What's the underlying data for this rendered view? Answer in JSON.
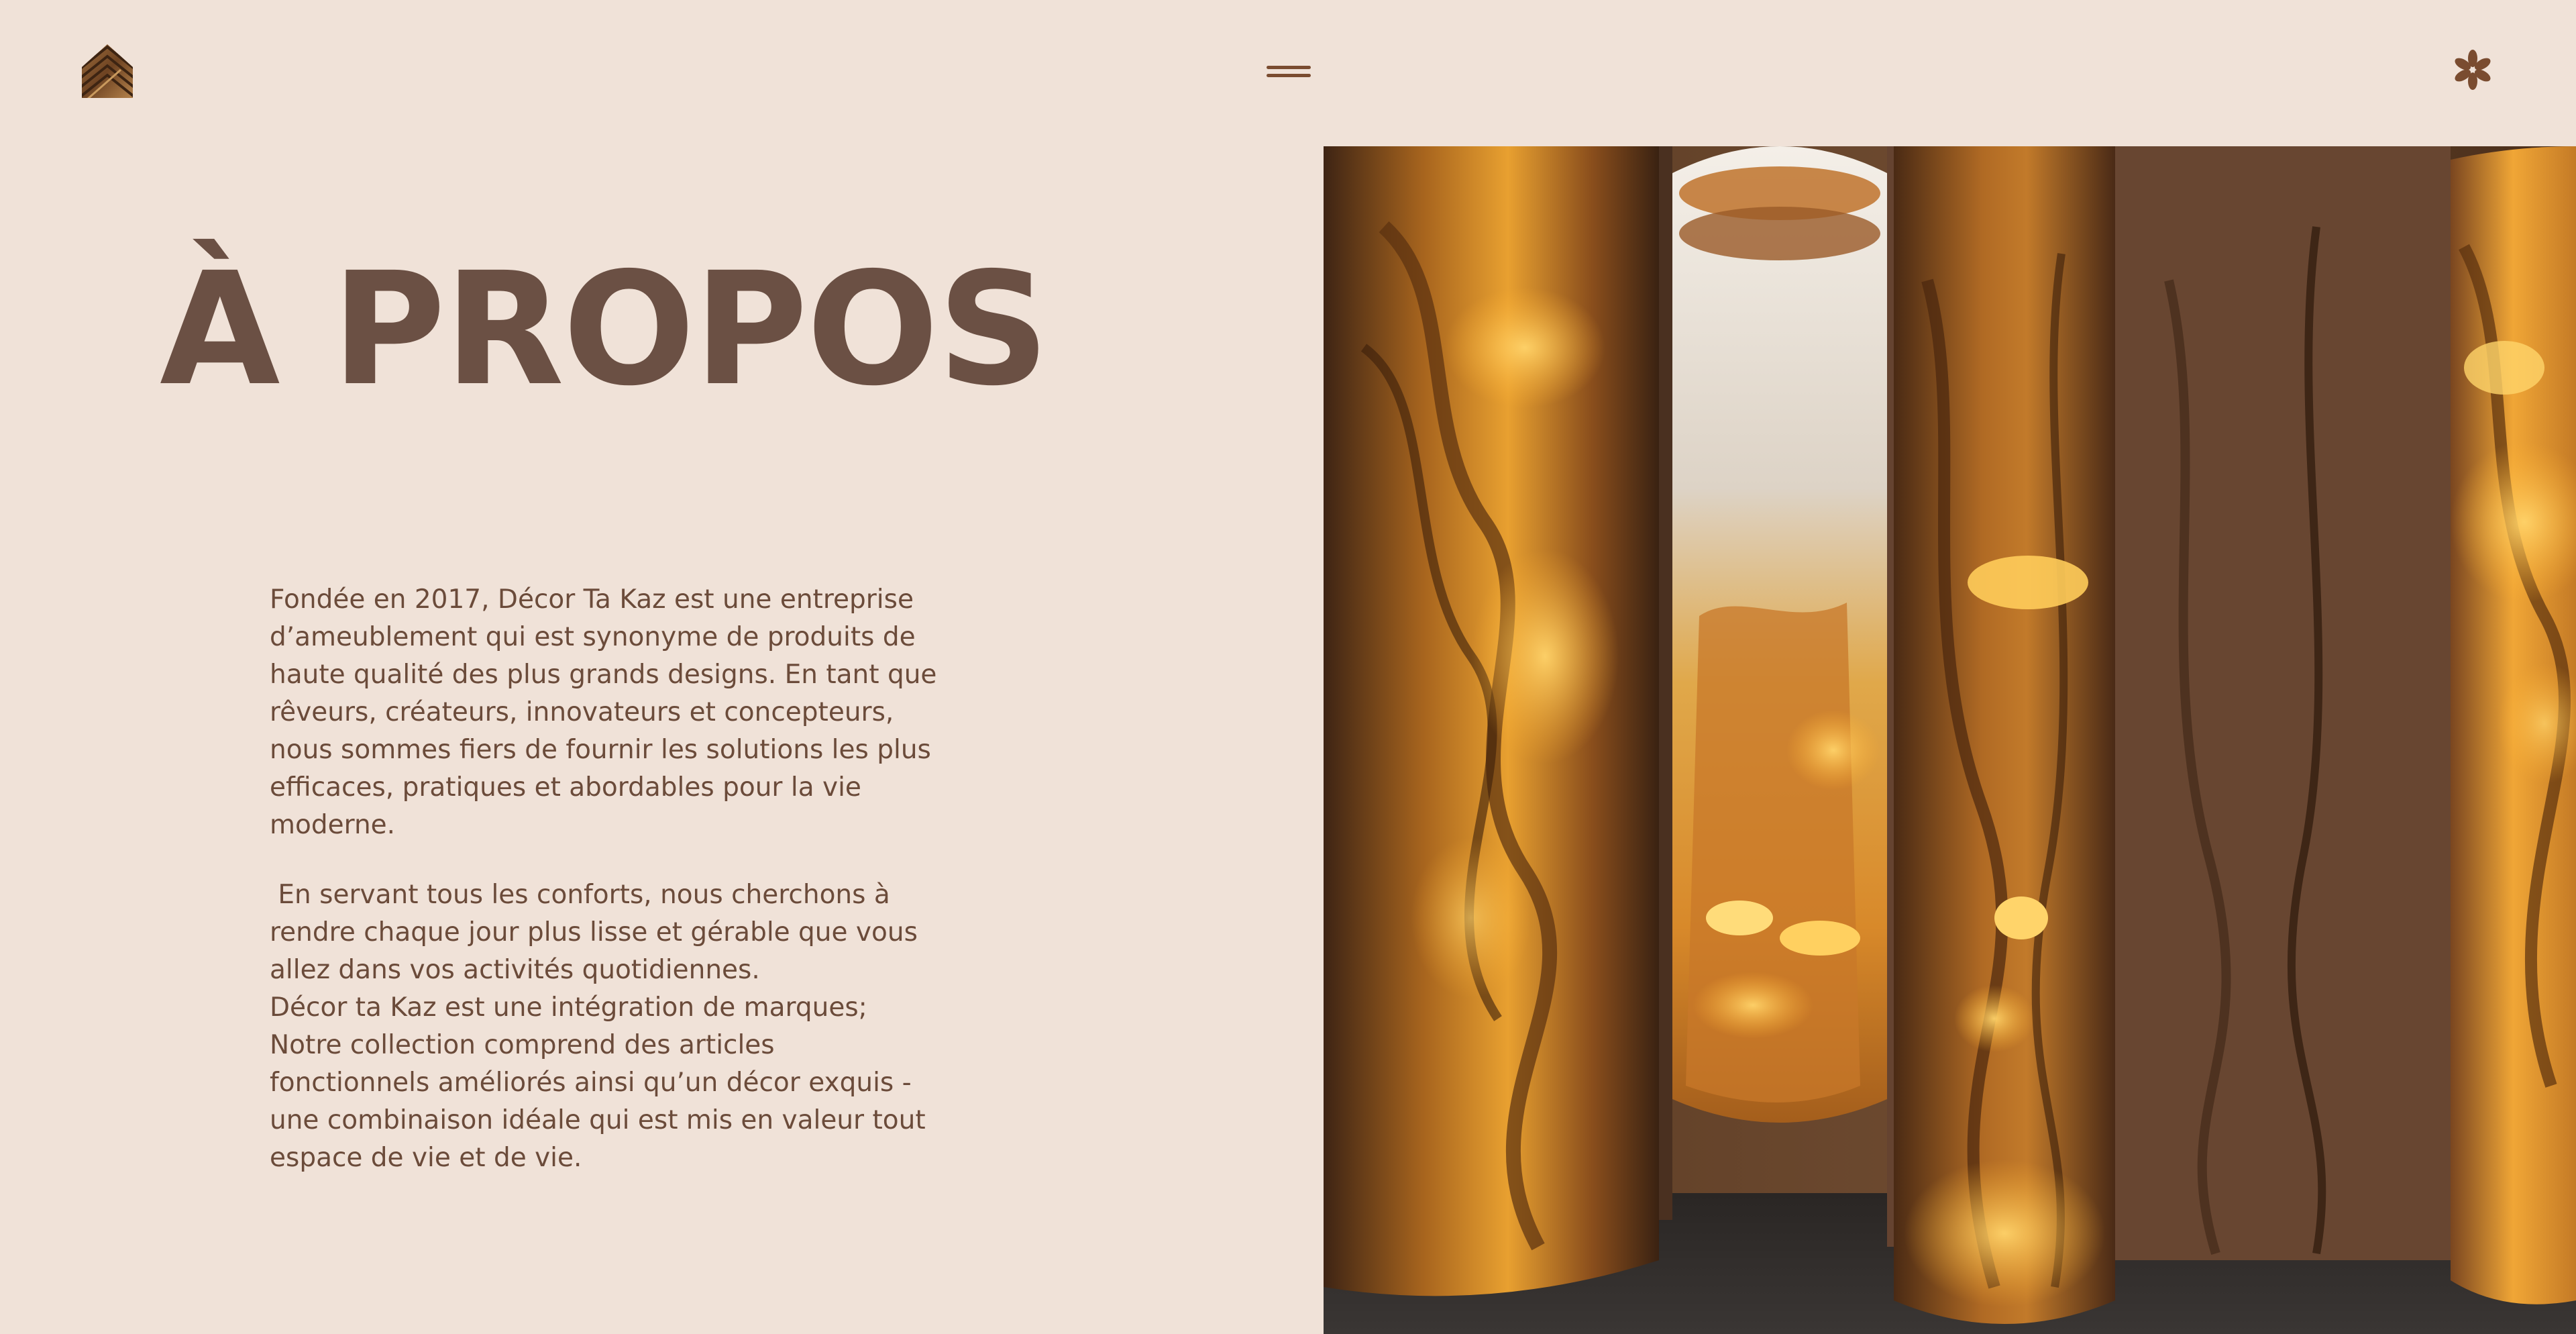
{
  "header": {
    "logo_icon": "wood-chevron-logo-icon",
    "menu_icon": "hamburger-menu-icon",
    "asterisk_icon": "asterisk-icon",
    "accent_color": "#7a4c30"
  },
  "about": {
    "title": "À PROPOS",
    "paragraph_1": [
      "Fondée en 2017, Décor Ta Kaz est une entreprise",
      "d’ameublement qui est synonyme de produits de",
      "haute qualité des plus grands designs. En tant que",
      "rêveurs, créateurs, innovateurs et concepteurs,",
      "nous sommes fiers de fournir les solutions les plus",
      "efficaces, pratiques et abordables pour la vie",
      "moderne."
    ],
    "paragraph_2": [
      " En servant tous les conforts, nous cherchons à",
      "rendre chaque jour plus lisse et gérable que vous",
      "allez dans vos activités quotidiennes.",
      "Décor ta Kaz est une intégration de marques;",
      "Notre collection comprend des articles",
      "fonctionnels améliorés ainsi qu’un décor exquis -",
      "une combinaison idéale qui est mis en valeur tout",
      "espace de vie et de vie."
    ]
  },
  "colors": {
    "background": "#f0e2d8",
    "title": "#6b5044",
    "text": "#6b4b3a"
  }
}
